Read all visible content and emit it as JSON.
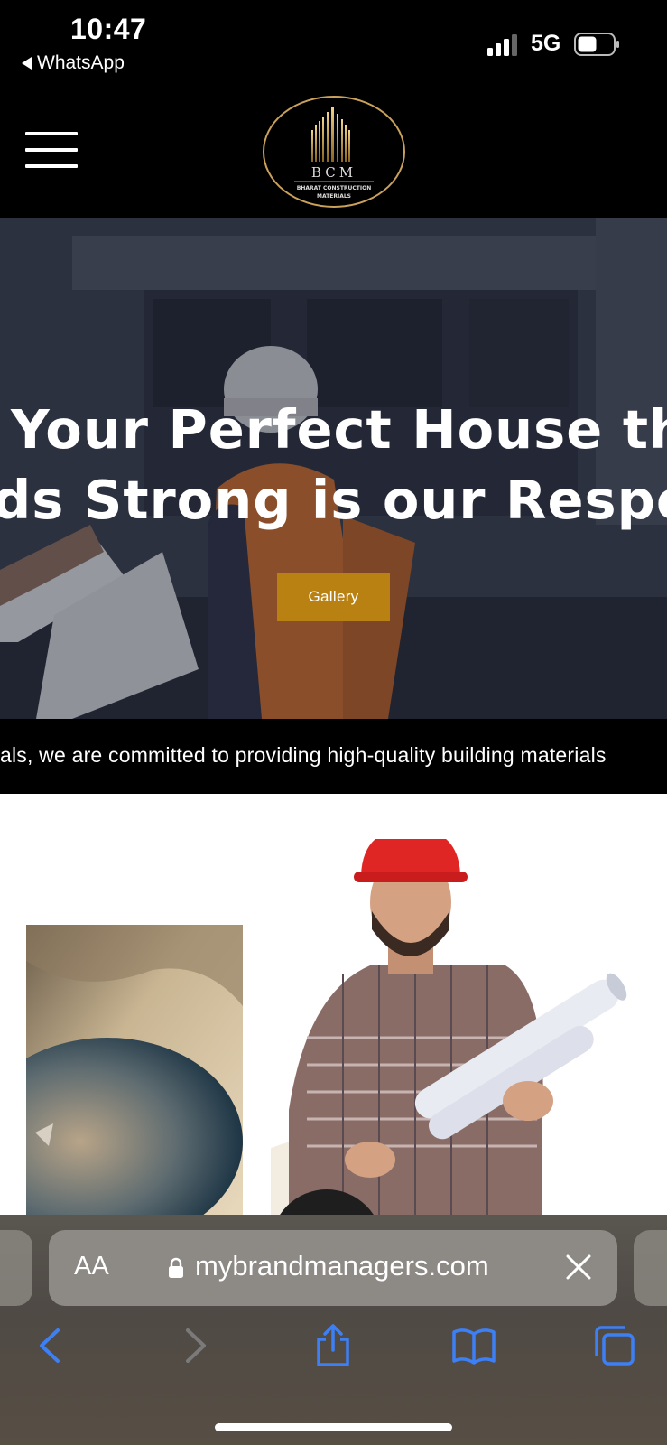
{
  "status_bar": {
    "time": "10:47",
    "back_app": "WhatsApp",
    "network": "5G"
  },
  "header": {
    "logo": {
      "initials": "BCM",
      "line1": "BHARAT CONSTRUCTION",
      "line2": "MATERIALS"
    }
  },
  "hero": {
    "title_line1": "Your Perfect House that",
    "title_line2": "ds Strong is our Responsi",
    "button_label": "Gallery",
    "button_color": "#b98111"
  },
  "marquee": {
    "text": "als, we are committed to providing high-quality building materials"
  },
  "browser": {
    "text_size_label": "AA",
    "url": "mybrandmanagers.com"
  },
  "colors": {
    "accent": "#b98111",
    "ios_blue": "#3d7ff5"
  }
}
